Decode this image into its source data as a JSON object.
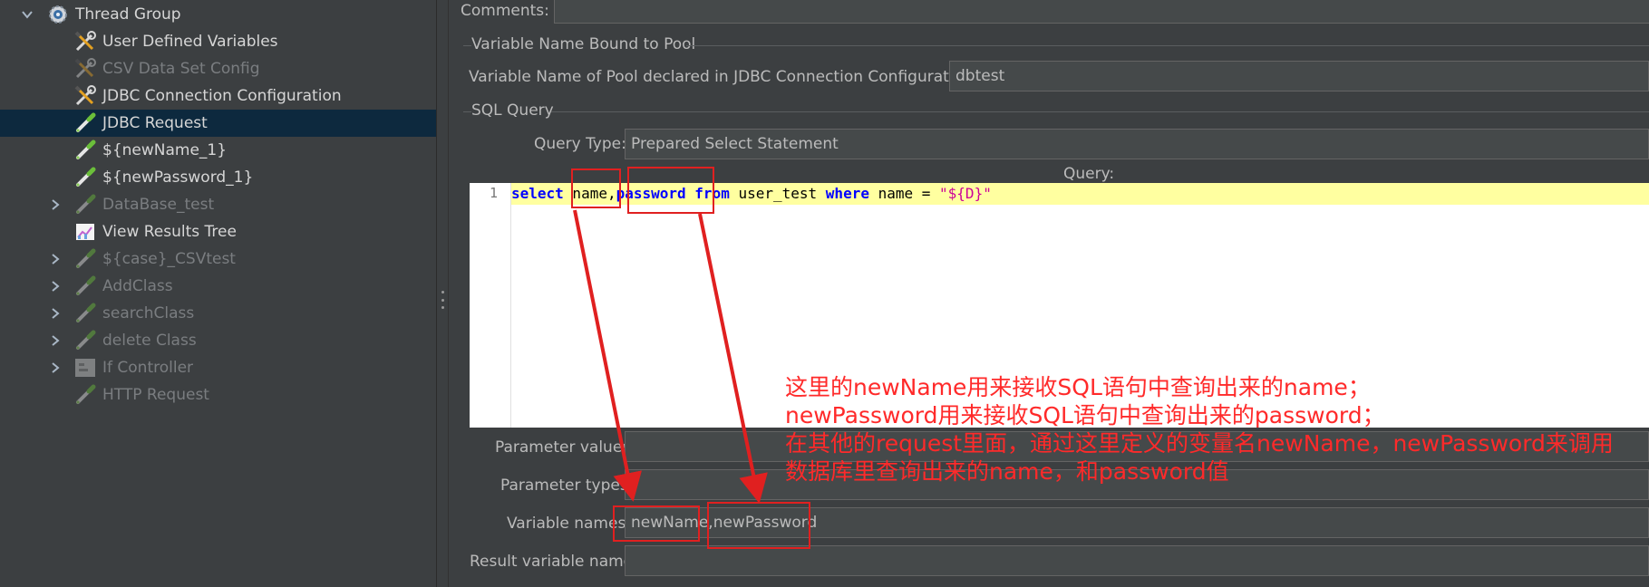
{
  "tree": {
    "items": [
      {
        "label": "Thread Group",
        "icon": "gear-icon",
        "enabled": true,
        "expanded": true,
        "arrow": "v",
        "level": 0
      },
      {
        "label": "User Defined Variables",
        "icon": "wrench-screwdriver-icon",
        "enabled": true,
        "level": 1
      },
      {
        "label": "CSV Data Set Config",
        "icon": "wrench-screwdriver-icon",
        "enabled": false,
        "level": 1
      },
      {
        "label": "JDBC Connection Configuration",
        "icon": "wrench-screwdriver-icon",
        "enabled": true,
        "level": 1
      },
      {
        "label": "JDBC Request",
        "icon": "pipette-icon",
        "enabled": true,
        "selected": true,
        "level": 1
      },
      {
        "label": "${newName_1}",
        "icon": "pipette-icon",
        "enabled": true,
        "level": 1
      },
      {
        "label": "${newPassword_1}",
        "icon": "pipette-icon",
        "enabled": true,
        "level": 1
      },
      {
        "label": "DataBase_test",
        "icon": "pipette-icon",
        "enabled": false,
        "arrow": ">",
        "level": 1
      },
      {
        "label": "View Results Tree",
        "icon": "chart-icon",
        "enabled": true,
        "level": 1
      },
      {
        "label": "${case}_CSVtest",
        "icon": "pipette-icon",
        "enabled": false,
        "arrow": ">",
        "level": 1
      },
      {
        "label": "AddClass",
        "icon": "pipette-icon",
        "enabled": false,
        "arrow": ">",
        "level": 1
      },
      {
        "label": "searchClass",
        "icon": "pipette-icon",
        "enabled": false,
        "arrow": ">",
        "level": 1
      },
      {
        "label": "delete Class",
        "icon": "pipette-icon",
        "enabled": false,
        "arrow": ">",
        "level": 1
      },
      {
        "label": "If Controller",
        "icon": "controller-icon",
        "enabled": false,
        "arrow": ">",
        "level": 1
      },
      {
        "label": "HTTP Request",
        "icon": "pipette-icon",
        "enabled": false,
        "level": 1
      }
    ]
  },
  "editor": {
    "comments_label": "Comments:",
    "pool_group_title": "Variable Name Bound to Pool",
    "pool_label": "Variable Name of Pool declared in JDBC Connection Configuration:",
    "pool_value": "dbtest",
    "sql_group_title": "SQL Query",
    "query_type_label": "Query Type:",
    "query_type_value": "Prepared Select Statement",
    "query_label": "Query:",
    "line_number": "1",
    "code_tokens": [
      {
        "t": "select",
        "c": "kw"
      },
      {
        "t": " name,",
        "c": ""
      },
      {
        "t": "password",
        "c": "kw"
      },
      {
        "t": " ",
        "c": ""
      },
      {
        "t": "from",
        "c": "kw"
      },
      {
        "t": " user_test ",
        "c": ""
      },
      {
        "t": "where",
        "c": "kw"
      },
      {
        "t": " name = ",
        "c": ""
      },
      {
        "t": "\"${D}\"",
        "c": "str"
      }
    ],
    "parameter_values_label": "Parameter values:",
    "parameter_values_value": "",
    "parameter_types_label": "Parameter types:",
    "parameter_types_value": "",
    "variable_names_label": "Variable names:",
    "variable_names_value": "newName,newPassword",
    "result_variable_label": "Result variable name:",
    "result_variable_value": ""
  },
  "annotation": {
    "color": "#ff2a2a",
    "lines": [
      "这里的newName用来接收SQL语句中查询出来的name；",
      "newPassword用来接收SQL语句中查询出来的password；",
      "在其他的request里面，通过这里定义的变量名newName，newPassword来调用",
      "数据库里查询出来的name，和password值"
    ]
  }
}
